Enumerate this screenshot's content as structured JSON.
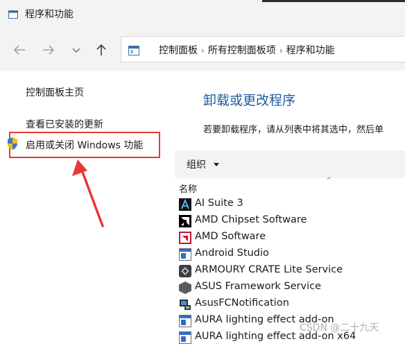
{
  "window": {
    "title": "程序和功能"
  },
  "navigation": {
    "breadcrumbs": [
      "控制面板",
      "所有控制面板项",
      "程序和功能"
    ]
  },
  "sidebar": {
    "home_link": "控制面板主页",
    "updates_link": "查看已安装的更新",
    "features_link": "启用或关闭 Windows 功能"
  },
  "main": {
    "heading": "卸载或更改程序",
    "description": "若要卸载程序，请从列表中将其选中，然后单",
    "organize_label": "组织",
    "column_name": "名称",
    "programs": [
      {
        "name": "AI Suite 3",
        "icon": "ai-suite-icon"
      },
      {
        "name": "AMD Chipset Software",
        "icon": "amd-logo-icon"
      },
      {
        "name": "AMD Software",
        "icon": "amd-software-icon"
      },
      {
        "name": "Android Studio",
        "icon": "window-app-icon"
      },
      {
        "name": "ARMOURY CRATE Lite Service",
        "icon": "armoury-crate-icon"
      },
      {
        "name": "ASUS Framework Service",
        "icon": "asus-framework-icon"
      },
      {
        "name": "AsusFCNotification",
        "icon": "installer-icon"
      },
      {
        "name": "AURA lighting effect add-on",
        "icon": "window-app-icon"
      },
      {
        "name": "AURA lighting effect add-on x64",
        "icon": "window-app-icon"
      }
    ]
  },
  "watermark": "CSDN @二十九天",
  "colors": {
    "accent_heading": "#1f5a9e",
    "highlight_box": "#e53935",
    "toolbar_bg": "#f3f3f3"
  }
}
